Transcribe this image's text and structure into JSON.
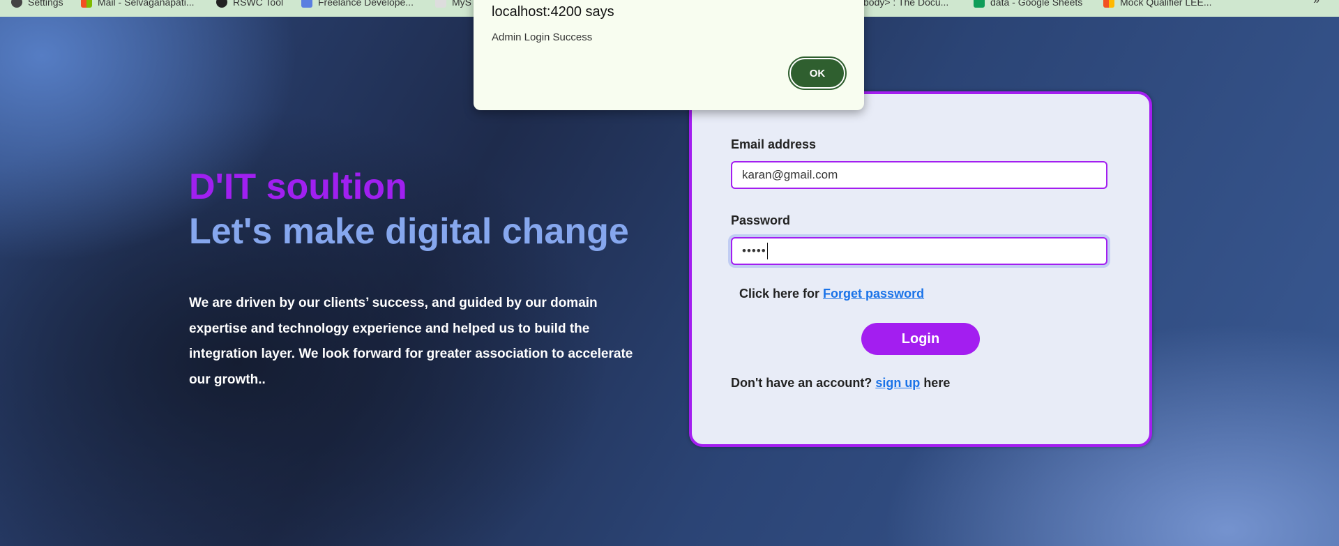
{
  "bookmarks": [
    {
      "label": "Settings",
      "icon": "gear-icon",
      "color": "#444444"
    },
    {
      "label": "Mail - Selvaganapati...",
      "icon": "microsoft-icon",
      "color": "#f25022"
    },
    {
      "label": "RSWC Tool",
      "icon": "github-icon",
      "color": "#222222"
    },
    {
      "label": "Freelance Develope...",
      "icon": "freelance-icon",
      "color": "#5b7fe0"
    },
    {
      "label": "MyS",
      "icon": "page-icon",
      "color": "#dddddd"
    },
    {
      "label": "body> : The Docu...",
      "icon": "docs-icon",
      "color": "#cccccc"
    },
    {
      "label": "data - Google Sheets",
      "icon": "sheets-icon",
      "color": "#0f9d58"
    },
    {
      "label": "Mock Qualifier LEE...",
      "icon": "microsoft-icon",
      "color": "#f25022"
    }
  ],
  "bookmarks_overflow": "»",
  "hero": {
    "brand": "D'IT soultion",
    "tagline": "Let's make digital change",
    "description": "We are driven by our clients’ success, and guided by our domain expertise and technology experience and helped us to build the integration layer. We look forward for greater association to accelerate our growth.."
  },
  "login": {
    "email_label": "Email address",
    "email_value": "karan@gmail.com",
    "password_label": "Password",
    "password_value": "•••••",
    "forgot_prefix": "Click here for ",
    "forgot_link": "Forget password",
    "login_button": "Login",
    "signup_prefix": "Don't have an account? ",
    "signup_link": "sign up",
    "signup_suffix": " here"
  },
  "alert": {
    "title": "localhost:4200 says",
    "message": "Admin Login Success",
    "ok_label": "OK"
  },
  "colors": {
    "accent": "#a31ef0",
    "tagline": "#86a7ee",
    "link": "#1a73e8",
    "ok_button": "#2f5f2f"
  }
}
